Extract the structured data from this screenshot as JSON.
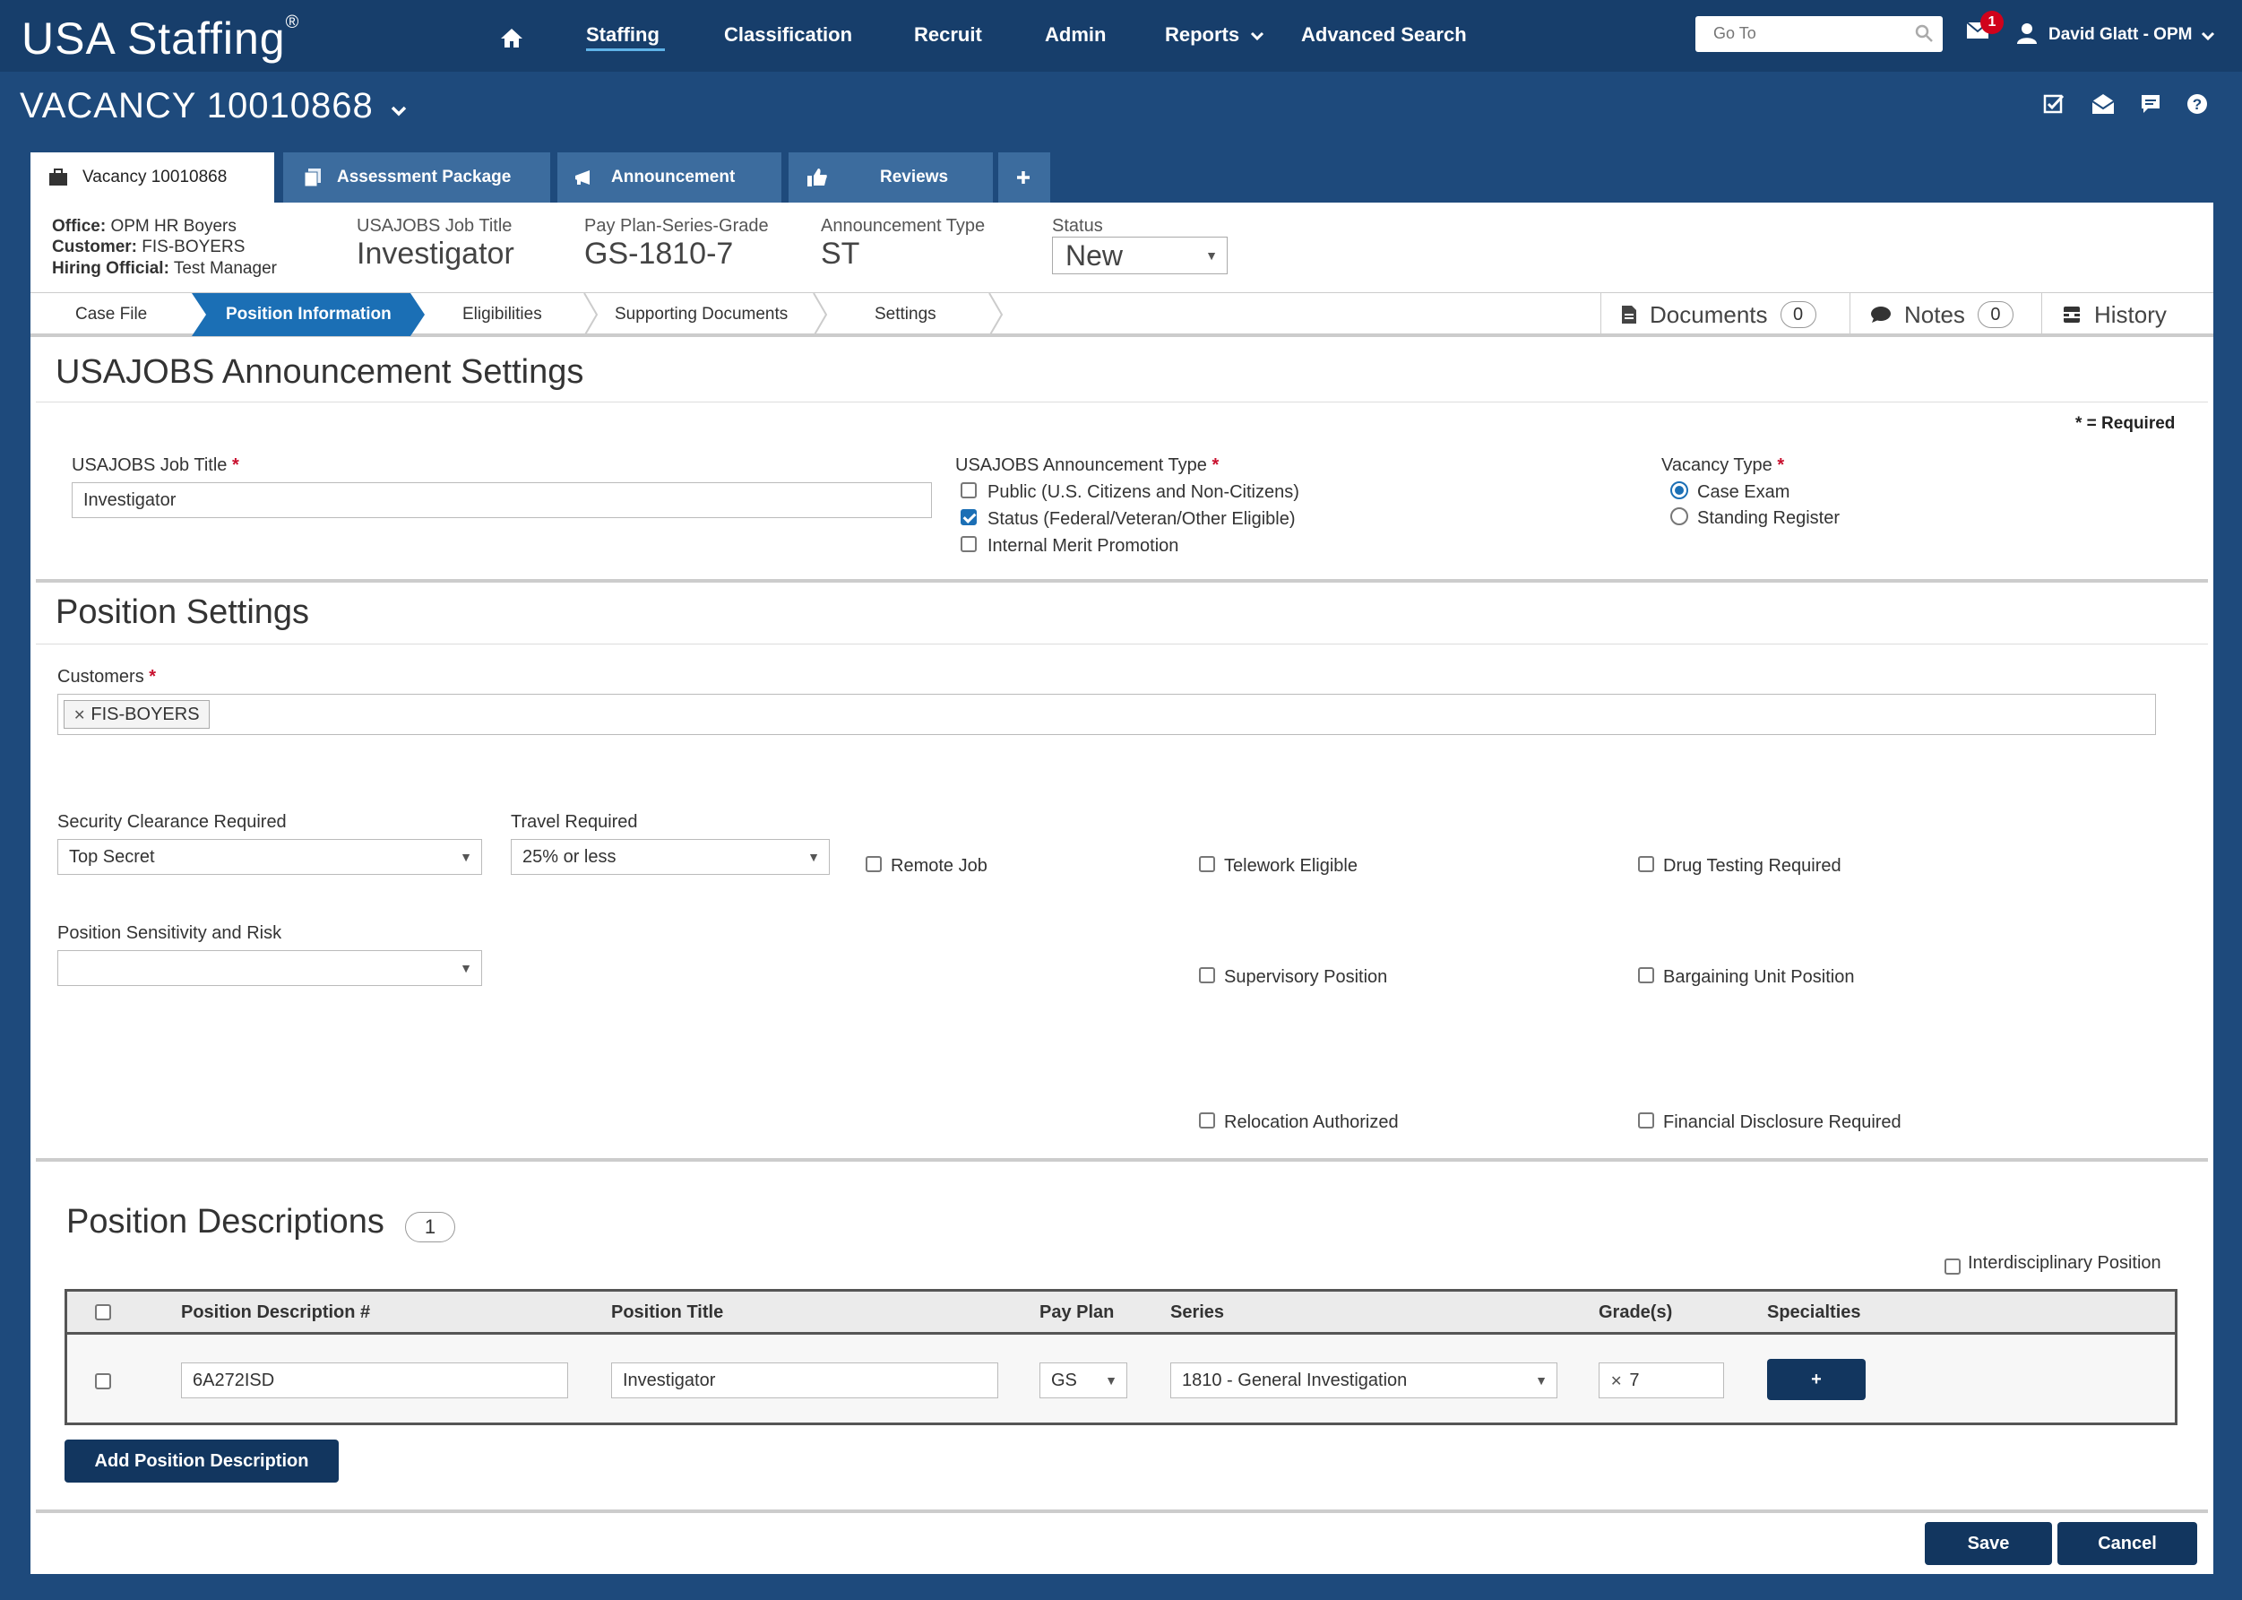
{
  "app": {
    "logo": "USA Staffing",
    "logo_mark": "®",
    "nav": [
      "Staffing",
      "Classification",
      "Recruit",
      "Admin",
      "Reports",
      "Advanced Search"
    ],
    "goto_placeholder": "Go To",
    "notifications": "1",
    "user": "David Glatt - OPM"
  },
  "vacancy": {
    "title": "VACANCY 10010868",
    "tabs": [
      "Vacancy 10010868",
      "Assessment Package",
      "Announcement",
      "Reviews"
    ],
    "office_label": "Office:",
    "office": "OPM HR Boyers",
    "customer_label": "Customer:",
    "customer": "FIS-BOYERS",
    "hiring_label": "Hiring Official:",
    "hiring": "Test Manager",
    "job_title_label": "USAJOBS Job Title",
    "job_title": "Investigator",
    "pay_label": "Pay Plan-Series-Grade",
    "pay": "GS-1810-7",
    "ann_type_label": "Announcement Type",
    "ann_type": "ST",
    "status_label": "Status",
    "status": "New"
  },
  "steps": [
    "Case File",
    "Position Information",
    "Eligibilities",
    "Supporting Documents",
    "Settings"
  ],
  "side_tabs": {
    "documents": "Documents",
    "documents_count": "0",
    "notes": "Notes",
    "notes_count": "0",
    "history": "History"
  },
  "usajobs": {
    "section_title": "USAJOBS Announcement Settings",
    "required_note": "* = Required",
    "job_title_label": "USAJOBS Job Title",
    "job_title_value": "Investigator",
    "ann_type_label": "USAJOBS Announcement Type",
    "ann_options": [
      {
        "label": "Public (U.S. Citizens and Non-Citizens)",
        "checked": false
      },
      {
        "label": "Status (Federal/Veteran/Other Eligible)",
        "checked": true
      },
      {
        "label": "Internal Merit Promotion",
        "checked": false
      }
    ],
    "vacancy_type_label": "Vacancy Type",
    "vacancy_types": [
      {
        "label": "Case Exam",
        "selected": true
      },
      {
        "label": "Standing Register",
        "selected": false
      }
    ]
  },
  "position": {
    "section_title": "Position Settings",
    "customers_label": "Customers",
    "customer_tag": "FIS-BOYERS",
    "security_label": "Security Clearance Required",
    "security_value": "Top Secret",
    "travel_label": "Travel Required",
    "travel_value": "25% or less",
    "sensitivity_label": "Position Sensitivity and Risk",
    "sensitivity_value": "",
    "checkboxes": {
      "remote": "Remote Job",
      "telework": "Telework Eligible",
      "drug": "Drug Testing Required",
      "supervisory": "Supervisory Position",
      "bargaining": "Bargaining Unit Position",
      "relocation": "Relocation Authorized",
      "financial": "Financial Disclosure Required"
    }
  },
  "pd": {
    "section_title": "Position Descriptions",
    "count": "1",
    "interdisciplinary": "Interdisciplinary Position",
    "headers": [
      "Position Description #",
      "Position Title",
      "Pay Plan",
      "Series",
      "Grade(s)",
      "Specialties"
    ],
    "row": {
      "pd_number": "6A272ISD",
      "title": "Investigator",
      "pay_plan": "GS",
      "series": "1810 - General Investigation",
      "grade": "7",
      "specialties_btn": "+"
    },
    "add_btn": "Add Position Description"
  },
  "footer": {
    "save": "Save",
    "cancel": "Cancel"
  }
}
